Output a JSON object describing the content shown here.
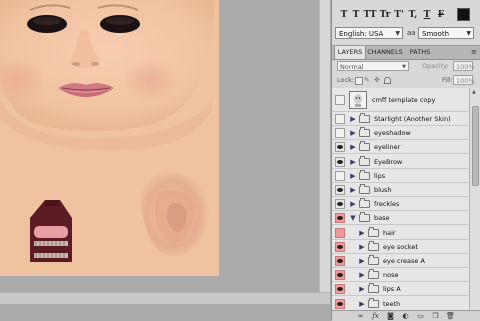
{
  "character_toolbar": {
    "buttons": [
      "T",
      "T",
      "TT",
      "Tr",
      "T'",
      "T,",
      "T",
      "F"
    ],
    "language": "English: USA",
    "aa_icon": "aa",
    "antialias": "Smooth",
    "text_color": "#111111"
  },
  "tabs": [
    {
      "label": "LAYERS",
      "active": true
    },
    {
      "label": "CHANNELS",
      "active": false
    },
    {
      "label": "PATHS",
      "active": false
    }
  ],
  "panel_menu_icon": "panel-menu-icon",
  "blend_mode": "Normal",
  "opacity_label": "Opacity:",
  "opacity_value": "100%",
  "lock_label": "Lock:",
  "fill_label": "Fill:",
  "fill_value": "100%",
  "layers": [
    {
      "name": "cmff template copy",
      "visible": false,
      "type": "image",
      "indent": 0,
      "expanded": false,
      "selected": false
    },
    {
      "name": "Starlight (Another Skin)",
      "visible": false,
      "type": "group",
      "indent": 0,
      "expanded": false,
      "selected": false
    },
    {
      "name": "eyeshadow",
      "visible": false,
      "type": "group",
      "indent": 0,
      "expanded": false,
      "selected": false
    },
    {
      "name": "eyeliner",
      "visible": true,
      "type": "group",
      "indent": 0,
      "expanded": false,
      "selected": false
    },
    {
      "name": "EyeBrow",
      "visible": true,
      "type": "group",
      "indent": 0,
      "expanded": false,
      "selected": false
    },
    {
      "name": "lips",
      "visible": false,
      "type": "group",
      "indent": 0,
      "expanded": false,
      "selected": false
    },
    {
      "name": "blush",
      "visible": true,
      "type": "group",
      "indent": 0,
      "expanded": false,
      "selected": false
    },
    {
      "name": "freckles",
      "visible": true,
      "type": "group",
      "indent": 0,
      "expanded": false,
      "selected": false
    },
    {
      "name": "base",
      "visible": true,
      "type": "group",
      "indent": 0,
      "expanded": true,
      "selected": false,
      "highlight": "#f29a9a"
    },
    {
      "name": "hair",
      "visible": false,
      "type": "group",
      "indent": 1,
      "expanded": false,
      "selected": false,
      "highlight": "#f29a9a"
    },
    {
      "name": "eye socket",
      "visible": true,
      "type": "group",
      "indent": 1,
      "expanded": false,
      "selected": false,
      "highlight": "#f29a9a"
    },
    {
      "name": "eye crease A",
      "visible": true,
      "type": "group",
      "indent": 1,
      "expanded": false,
      "selected": false,
      "highlight": "#f29a9a"
    },
    {
      "name": "nose",
      "visible": true,
      "type": "group",
      "indent": 1,
      "expanded": false,
      "selected": false,
      "highlight": "#f29a9a"
    },
    {
      "name": "lips A",
      "visible": true,
      "type": "group",
      "indent": 1,
      "expanded": false,
      "selected": false,
      "highlight": "#f29a9a"
    },
    {
      "name": "teeth",
      "visible": true,
      "type": "group",
      "indent": 1,
      "expanded": false,
      "selected": false,
      "highlight": "#f29a9a"
    }
  ],
  "footer_icons": [
    "link-icon",
    "fx-icon",
    "mask-icon",
    "adjustment-icon",
    "new-group-icon",
    "new-layer-icon",
    "trash-icon"
  ],
  "colors": {
    "skin": "#f0c3a0",
    "panel_bg": "#d8d8d8",
    "layer_highlight": "#f29a9a",
    "canvas_bg": "#ababab"
  }
}
